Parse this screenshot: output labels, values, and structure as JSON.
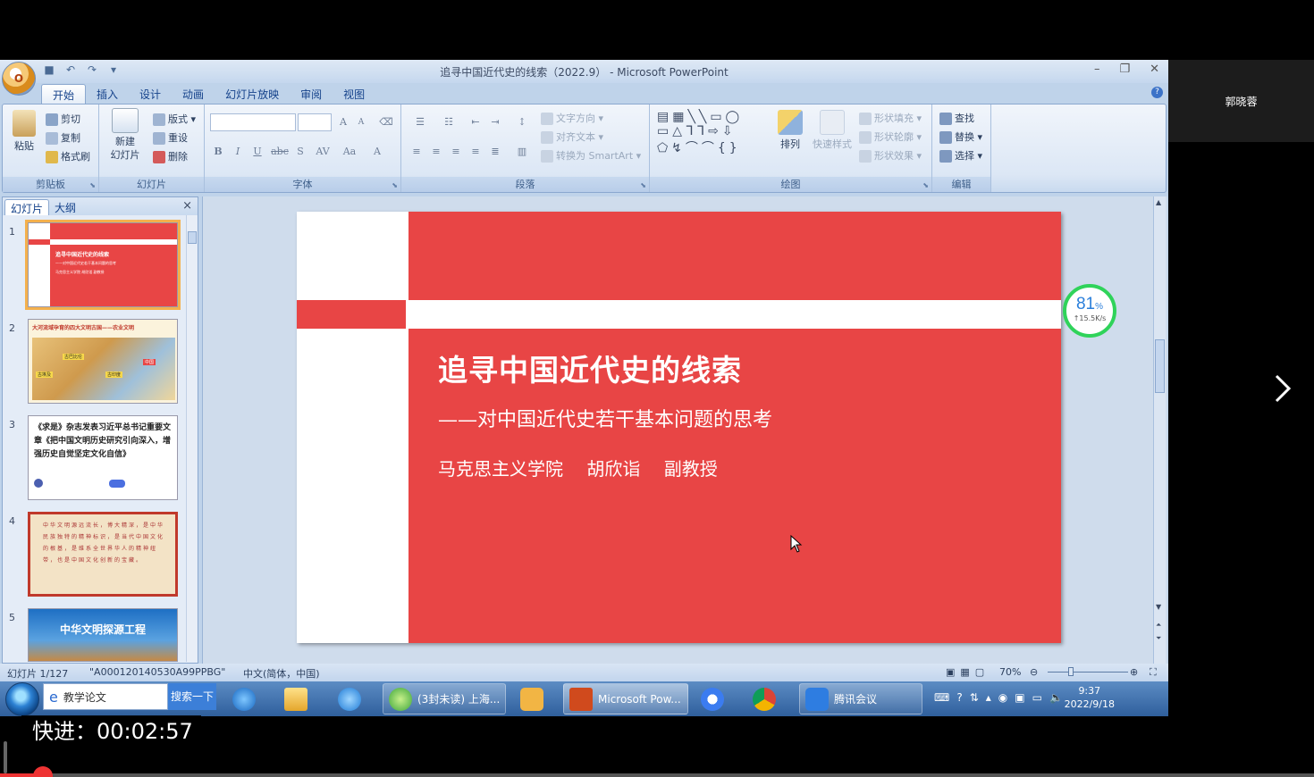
{
  "window": {
    "title": "追寻中国近代史的线索（2022.9） - Microsoft PowerPoint",
    "office_button": "O"
  },
  "ribbon_tabs": [
    "开始",
    "插入",
    "设计",
    "动画",
    "幻灯片放映",
    "审阅",
    "视图"
  ],
  "ribbon": {
    "clipboard": {
      "paste": "粘贴",
      "cut": "剪切",
      "copy": "复制",
      "format_painter": "格式刷",
      "label": "剪贴板"
    },
    "slides": {
      "new_slide": "新建",
      "new_slide_2": "幻灯片",
      "layout": "版式",
      "reset": "重设",
      "delete": "删除",
      "label": "幻灯片"
    },
    "font": {
      "label": "字体",
      "grow": "A",
      "shrink": "A",
      "bold": "B",
      "italic": "I",
      "underline": "U",
      "strike": "abc",
      "shadow": "S",
      "spacing": "AV",
      "case": "Aa",
      "color": "A"
    },
    "paragraph": {
      "label": "段落",
      "text_direction": "文字方向",
      "align_text": "对齐文本",
      "smartart": "转换为 SmartArt"
    },
    "drawing": {
      "label": "绘图",
      "arrange": "排列",
      "quick_styles": "快速样式",
      "shape_fill": "形状填充",
      "shape_outline": "形状轮廓",
      "shape_effects": "形状效果"
    },
    "editing": {
      "label": "编辑",
      "find": "查找",
      "replace": "替换",
      "select": "选择"
    }
  },
  "panel_tabs": {
    "slides": "幻灯片",
    "outline": "大纲",
    "close": "×"
  },
  "thumbnails": [
    {
      "num": "1",
      "title": "追寻中国近代史的线索",
      "line": "——对中国近代史若干基本问题的思考",
      "author": "马克思主义学院 胡欣诣 副教授"
    },
    {
      "num": "2",
      "title": "大河流域孕育的四大文明古国——农业文明",
      "labels": [
        "古巴比伦",
        "古埃及",
        "古印度",
        "中国"
      ]
    },
    {
      "num": "3",
      "title": "《求是》杂志发表习近平总书记重要文章《把中国文明历史研究引向深入，增强历史自觉坚定文化自信》",
      "badge": ""
    },
    {
      "num": "4",
      "title": "中华文明源远流长，博大精深，是中华民族独特的精神标识，是当代中国文化的根基，是维系全世界华人的精神纽带，也是中国文化创新的宝藏。"
    },
    {
      "num": "5",
      "title": "中华文明探源工程"
    }
  ],
  "slide": {
    "title": "追寻中国近代史的线索",
    "subtitle": "——对中国近代史若干基本问题的思考",
    "author": "马克思主义学院 胡欣诣 副教授"
  },
  "net_widget": {
    "percent": "81",
    "unit": "%",
    "speed": "↑15.5K/s"
  },
  "statusbar": {
    "slide_pos": "幻灯片 1/127",
    "theme": "\"A000120140530A99PPBG\"",
    "language": "中文(简体，中国)",
    "zoom": "70%"
  },
  "taskbar": {
    "search_text": "教学论文",
    "search_button": "搜索一下",
    "items": [
      "(3封未读) 上海...",
      "Microsoft Pow...",
      "腾讯会议"
    ],
    "time": "9:37",
    "date": "2022/9/18"
  },
  "meeting": {
    "participant": "郭晓蓉"
  },
  "overlay": {
    "fast_forward": "快进：00:02:57",
    "progress": 0.03
  },
  "colors": {
    "slide_red": "#e84545",
    "ribbon_blue": "#dce7f5",
    "accent": "#15428b"
  }
}
